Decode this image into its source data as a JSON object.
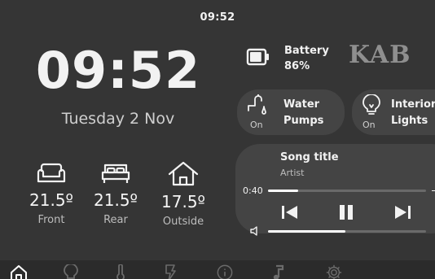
{
  "status_bar": {
    "time": "09:52"
  },
  "clock": {
    "time": "09:52",
    "date": "Tuesday 2 Nov"
  },
  "temperatures": [
    {
      "icon": "sofa-icon",
      "value": "21.5º",
      "label": "Front"
    },
    {
      "icon": "bed-icon",
      "value": "21.5º",
      "label": "Rear"
    },
    {
      "icon": "house-icon",
      "value": "17.5º",
      "label": "Outside"
    }
  ],
  "battery": {
    "label": "Battery",
    "percent_text": "86%",
    "level": 0.86
  },
  "logo": {
    "text": "KAB"
  },
  "toggles": [
    {
      "icon": "water-tap-icon",
      "state": "On",
      "label_line1": "Water",
      "label_line2": "Pumps"
    },
    {
      "icon": "lightbulb-icon",
      "state": "On",
      "label_line1": "Interior",
      "label_line2": "Lights"
    }
  ],
  "media": {
    "title": "Song title",
    "artist": "Artist",
    "position": "0:40",
    "progress": 0.19,
    "volume": 0.49
  },
  "nav": [
    {
      "icon": "home-icon",
      "active": true
    },
    {
      "icon": "lightbulb-icon",
      "active": false
    },
    {
      "icon": "thermometer-icon",
      "active": false
    },
    {
      "icon": "power-icon",
      "active": false
    },
    {
      "icon": "info-icon",
      "active": false
    },
    {
      "icon": "music-note-icon",
      "active": false
    },
    {
      "icon": "settings-gear-icon",
      "active": false
    }
  ],
  "colors": {
    "background": "#353535",
    "panel": "#444444",
    "text": "#f2f2f2",
    "muted": "#bdbdbd",
    "nav_inactive": "#6b6b6b"
  }
}
